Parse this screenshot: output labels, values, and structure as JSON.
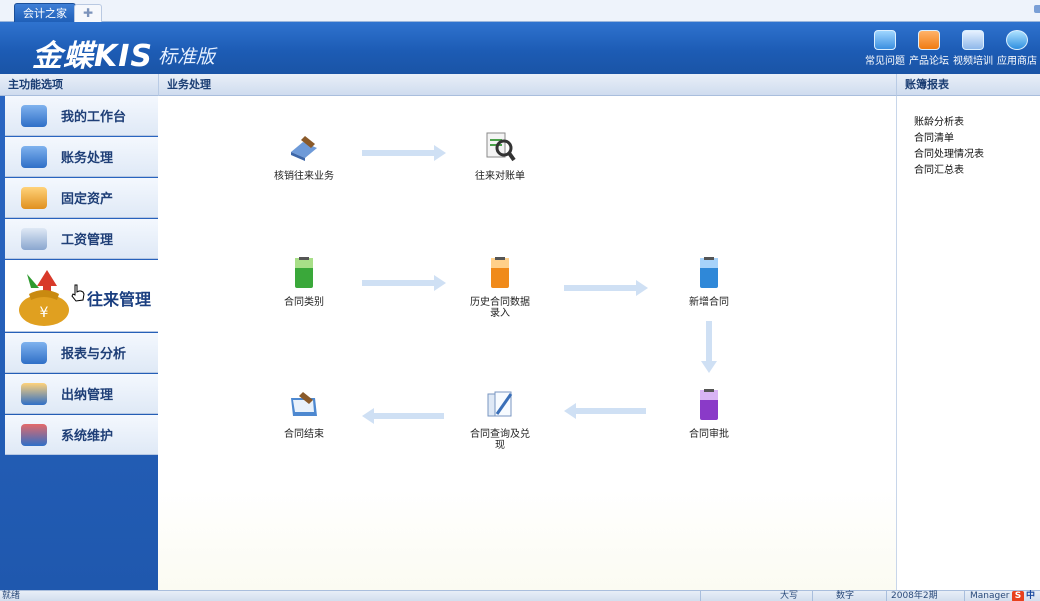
{
  "tabs": {
    "active": "会计之家",
    "add": "✚"
  },
  "banner": {
    "logo": "金蝶KIS",
    "edition": "标准版",
    "tools": [
      {
        "label": "常见问题",
        "icon": "faq-icon"
      },
      {
        "label": "产品论坛",
        "icon": "forum-icon"
      },
      {
        "label": "视频培训",
        "icon": "video-training-icon"
      },
      {
        "label": "应用商店",
        "icon": "app-store-icon"
      }
    ]
  },
  "sidebar": {
    "header": "主功能选项",
    "items": [
      {
        "label": "我的工作台",
        "icon": "monitor-icon"
      },
      {
        "label": "账务处理",
        "icon": "ledger-icon"
      },
      {
        "label": "固定资产",
        "icon": "fixed-asset-icon"
      },
      {
        "label": "工资管理",
        "icon": "payroll-icon"
      },
      {
        "label": "往来管理",
        "icon": "money-bag-icon",
        "active": true
      },
      {
        "label": "报表与分析",
        "icon": "report-icon"
      },
      {
        "label": "出纳管理",
        "icon": "cashier-icon"
      },
      {
        "label": "系统维护",
        "icon": "system-icon"
      }
    ]
  },
  "main": {
    "header": "业务处理",
    "nodes": {
      "writeoff": "核销往来业务",
      "reconcile": "往来对账单",
      "contract_type": "合同类别",
      "history_entry": "历史合同数据录入",
      "new_contract": "新增合同",
      "contract_close": "合同结束",
      "contract_query": "合同查询及兑现",
      "contract_approve": "合同审批"
    }
  },
  "right_panel": {
    "header": "账簿报表",
    "links": [
      "账龄分析表",
      "合同清单",
      "合同处理情况表",
      "合同汇总表"
    ]
  },
  "status": {
    "left": "就绪",
    "caps": "大写",
    "num": "数字",
    "period": "2008年2期",
    "user": "Manager",
    "ime": "中"
  },
  "colors": {
    "banner": "#1d5cb5",
    "sidebar": "#1f58ae",
    "header": "#1a3d73"
  }
}
